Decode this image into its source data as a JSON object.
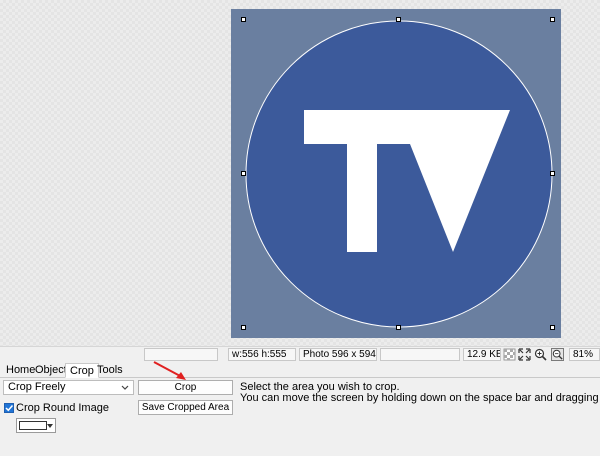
{
  "status": {
    "dimensions": "w:556 h:555",
    "photo_size": "Photo 596 x 594",
    "file_size": "12.9 KB",
    "zoom": "81%"
  },
  "tabs": [
    {
      "label": "Home"
    },
    {
      "label": "Object"
    },
    {
      "label": "Crop"
    },
    {
      "label": "Tools"
    }
  ],
  "crop_panel": {
    "mode_select_value": "Crop Freely",
    "crop_button_label": "Crop",
    "save_button_label": "Save Cropped Area",
    "round_image_label": "Crop Round Image",
    "round_image_checked": true,
    "instruction_line1": "Select the area you wish to crop.",
    "instruction_line2": "You can move the screen by holding down on the space bar and dragging the area with your m"
  },
  "logo_text": "TV",
  "colors": {
    "circle_fill": "#3c5a9b",
    "frame_fill": "#6a7fa0",
    "accent_arrow": "#e02020"
  }
}
